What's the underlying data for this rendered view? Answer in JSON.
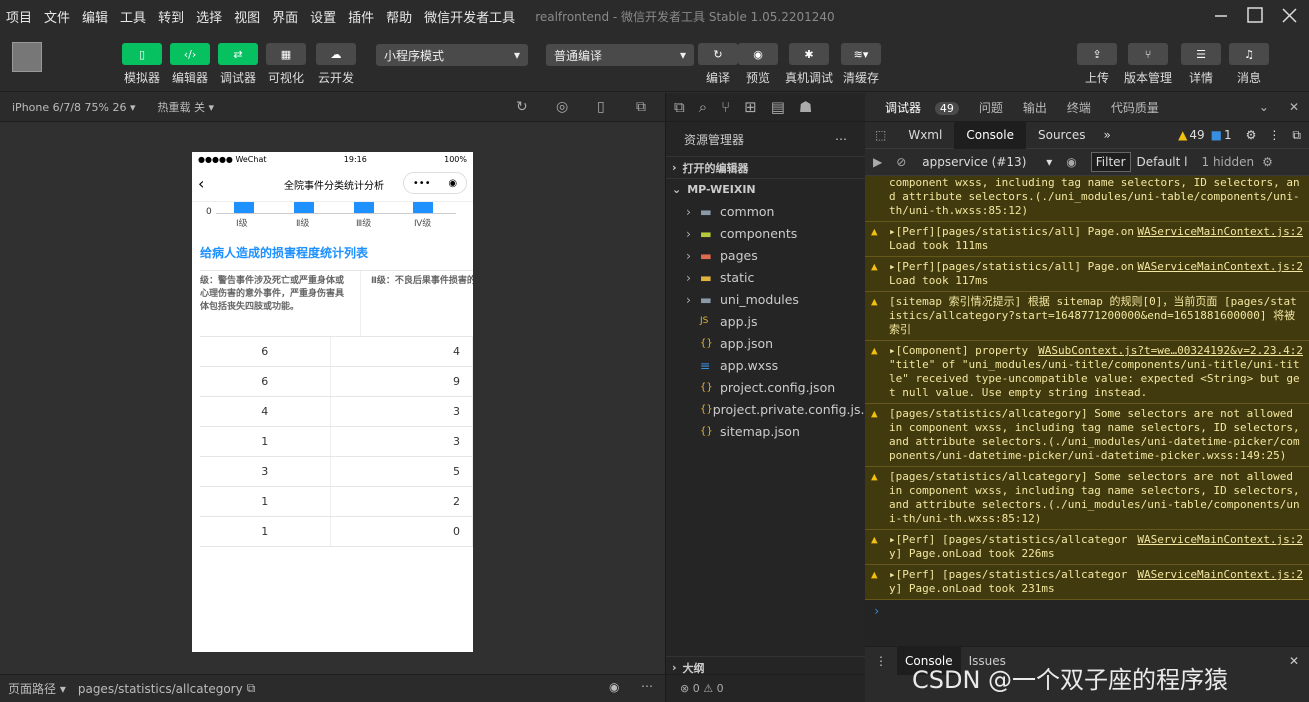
{
  "menu": [
    "项目",
    "文件",
    "编辑",
    "工具",
    "转到",
    "选择",
    "视图",
    "界面",
    "设置",
    "插件",
    "帮助",
    "微信开发者工具"
  ],
  "window_title": "realfrontend - 微信开发者工具 Stable 1.05.2201240",
  "toolbar": {
    "left_buttons": [
      {
        "label": "模拟器",
        "icon": "phone-icon",
        "active": true
      },
      {
        "label": "编辑器",
        "icon": "code-icon",
        "active": true
      },
      {
        "label": "调试器",
        "icon": "debug-icon",
        "active": true
      },
      {
        "label": "可视化",
        "icon": "layout-icon",
        "active": false
      },
      {
        "label": "云开发",
        "icon": "cloud-icon",
        "active": false
      }
    ],
    "mode_select": "小程序模式",
    "compile_select": "普通编译",
    "mid_buttons": [
      {
        "label": "编译",
        "icon": "refresh-icon"
      },
      {
        "label": "预览",
        "icon": "eye-icon"
      },
      {
        "label": "真机调试",
        "icon": "bug-icon"
      },
      {
        "label": "清缓存",
        "icon": "layers-icon"
      }
    ],
    "right_buttons": [
      {
        "label": "上传",
        "icon": "upload-icon"
      },
      {
        "label": "版本管理",
        "icon": "branch-icon"
      },
      {
        "label": "详情",
        "icon": "menu-icon"
      },
      {
        "label": "消息",
        "icon": "bell-icon"
      }
    ]
  },
  "simulator": {
    "device": "iPhone 6/7/8 75% 26 ▾",
    "hot_reload": "热重载 关 ▾",
    "phone": {
      "status_carrier": "●●●●● WeChat",
      "status_time": "19:16",
      "status_battery": "100%",
      "nav_title": "全院事件分类统计分析",
      "capsule_more": "•••",
      "axis_zero": "0",
      "axis_labels": [
        "Ⅰ级",
        "Ⅱ级",
        "Ⅲ级",
        "Ⅳ级"
      ],
      "section_title": "给病人造成的损害程度统计列表",
      "table_headers": [
        "级：警告事件涉及死亡或严重身体或心理伤害的意外事件，严重身伤害具体包括丧失四肢或功能。",
        "Ⅱ级：不良后果事件损害的事"
      ],
      "table_rows": [
        [
          "6",
          "4"
        ],
        [
          "6",
          "9"
        ],
        [
          "4",
          "3"
        ],
        [
          "1",
          "3"
        ],
        [
          "3",
          "5"
        ],
        [
          "1",
          "2"
        ],
        [
          "1",
          "0"
        ]
      ]
    }
  },
  "bottom": {
    "path_label": "页面路径 ▾",
    "path": "pages/statistics/allcategory"
  },
  "explorer": {
    "title": "资源管理器",
    "open_editors": "打开的编辑器",
    "project": "MP-WEIXIN",
    "items": [
      {
        "name": "common",
        "type": "folder"
      },
      {
        "name": "components",
        "type": "folder"
      },
      {
        "name": "pages",
        "type": "folder"
      },
      {
        "name": "static",
        "type": "folder"
      },
      {
        "name": "uni_modules",
        "type": "folder"
      },
      {
        "name": "app.js",
        "type": "js"
      },
      {
        "name": "app.json",
        "type": "json"
      },
      {
        "name": "app.wxss",
        "type": "wxss"
      },
      {
        "name": "project.config.json",
        "type": "json"
      },
      {
        "name": "project.private.config.js...",
        "type": "json"
      },
      {
        "name": "sitemap.json",
        "type": "json"
      }
    ],
    "outline": "大纲",
    "status_counts": "⊗ 0 ⚠ 0"
  },
  "devtools": {
    "tabs": [
      "调试器",
      "问题",
      "输出",
      "终端",
      "代码质量"
    ],
    "debugger_badge": "49",
    "sub_tabs": [
      "Wxml",
      "Console",
      "Sources"
    ],
    "warn_count": "49",
    "info_count": "1",
    "context": "appservice (#13)",
    "filter": "Filter",
    "levels": "Default l",
    "hidden": "1 hidden",
    "messages": [
      {
        "text": "component wxss, including tag name selectors, ID selectors, and attribute selectors.(./uni_modules/uni-table/components/uni-th/uni-th.wxss:85:12)",
        "src": "",
        "warn": false
      },
      {
        "text": "▸[Perf][pages/statistics/all] Page.onLoad took 111ms",
        "src": "WAServiceMainContext.js:2",
        "warn": true
      },
      {
        "text": "▸[Perf][pages/statistics/all] Page.onLoad took 117ms",
        "src": "WAServiceMainContext.js:2",
        "warn": true
      },
      {
        "text": "[sitemap 索引情况提示] 根据 sitemap 的规则[0]，当前页面 [pages/statistics/allcategory?start=1648771200000&end=1651881600000] 将被索引",
        "src": "",
        "warn": true
      },
      {
        "text": "▸[Component] property \"title\" of \"uni_modules/uni-title/components/uni-title/uni-title\" received type-uncompatible value: expected <String> but get null value. Use empty string instead.",
        "src": "WASubContext.js?t=we…00324192&v=2.23.4:2",
        "warn": true
      },
      {
        "text": "[pages/statistics/allcategory] Some selectors are not allowed in component wxss, including tag name selectors, ID selectors, and attribute selectors.(./uni_modules/uni-datetime-picker/components/uni-datetime-picker/uni-datetime-picker.wxss:149:25)",
        "src": "",
        "warn": true
      },
      {
        "text": "[pages/statistics/allcategory] Some selectors are not allowed in component wxss, including tag name selectors, ID selectors, and attribute selectors.(./uni_modules/uni-table/components/uni-th/uni-th.wxss:85:12)",
        "src": "",
        "warn": true
      },
      {
        "text": "▸[Perf] [pages/statistics/allcategory] Page.onLoad took 226ms",
        "src": "WAServiceMainContext.js:2",
        "warn": true
      },
      {
        "text": "▸[Perf] [pages/statistics/allcategory] Page.onLoad took 231ms",
        "src": "WAServiceMainContext.js:2",
        "warn": true
      }
    ],
    "bottom_tabs": [
      "Console",
      "Issues"
    ]
  },
  "watermark": "CSDN @一个双子座的程序猿"
}
